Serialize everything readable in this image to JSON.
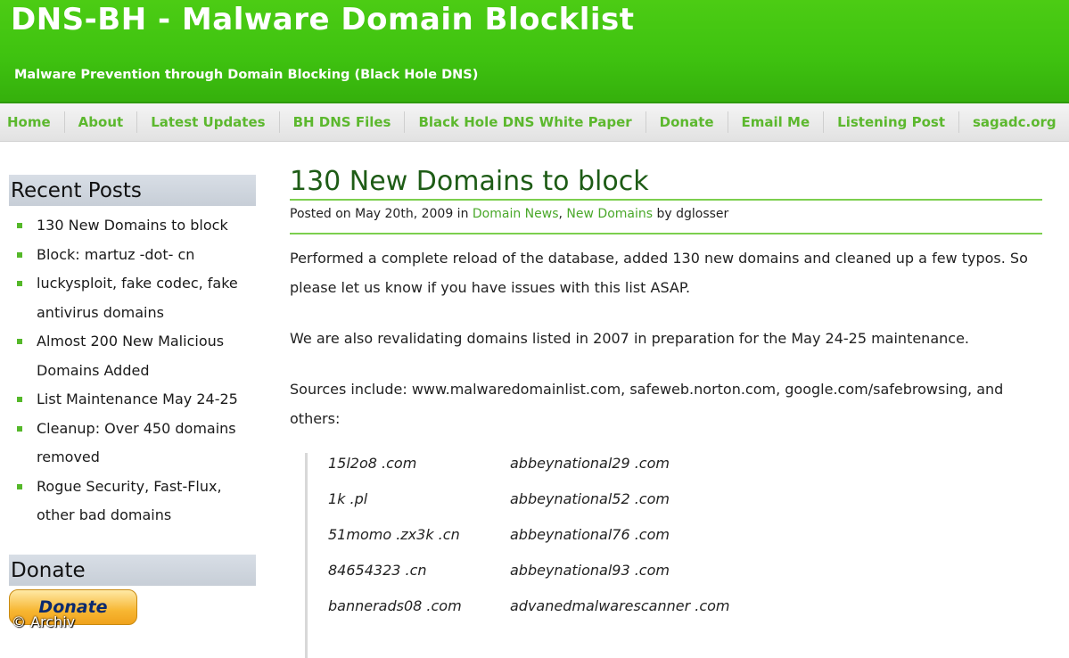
{
  "header": {
    "title": "DNS-BH - Malware Domain Blocklist",
    "tagline": "Malware Prevention through Domain Blocking (Black Hole DNS)"
  },
  "nav": {
    "items": [
      "Home",
      "About",
      "Latest Updates",
      "BH DNS Files",
      "Black Hole DNS White Paper",
      "Donate",
      "Email Me",
      "Listening Post",
      "sagadc.org"
    ]
  },
  "sidebar": {
    "recent_title": "Recent Posts",
    "recent_posts": [
      "130 New Domains to block",
      "Block: martuz -dot- cn",
      "luckysploit, fake codec, fake antivirus domains",
      "Almost 200 New Malicious Domains Added",
      "List Maintenance May 24-25",
      "Cleanup: Over 450 domains removed",
      "Rogue Security, Fast-Flux, other bad domains"
    ],
    "donate_title": "Donate",
    "donate_button": "Donate"
  },
  "watermark": "© Archiv",
  "post": {
    "title": "130 New Domains to block",
    "meta_prefix": "Posted on May 20th, 2009 in ",
    "category1": "Domain News",
    "separator": ", ",
    "category2": "New Domains",
    "meta_suffix": " by dglosser",
    "paragraph1": "Performed a complete reload of the database, added 130 new domains and cleaned up a few typos. So please let us know if you have issues with this list ASAP.",
    "paragraph2": "We are also revalidating domains listed in 2007 in preparation for the May 24-25 maintenance.",
    "paragraph3": "Sources include: www.malwaredomainlist.com, safeweb.norton.com, google.com/safebrowsing, and others:",
    "domains": [
      [
        "15l2o8 .com",
        "abbeynational29 .com"
      ],
      [
        "1k .pl",
        "abbeynational52 .com"
      ],
      [
        "51momo .zx3k .cn",
        "abbeynational76 .com"
      ],
      [
        "84654323 .cn",
        "abbeynational93 .com"
      ],
      [
        "bannerads08 .com",
        "advanedmalwarescanner .com"
      ]
    ]
  },
  "colors": {
    "header_green": "#3fc310",
    "nav_link": "#5cb82e",
    "title_green": "#1e5c16",
    "link_green": "#4aa82a"
  }
}
